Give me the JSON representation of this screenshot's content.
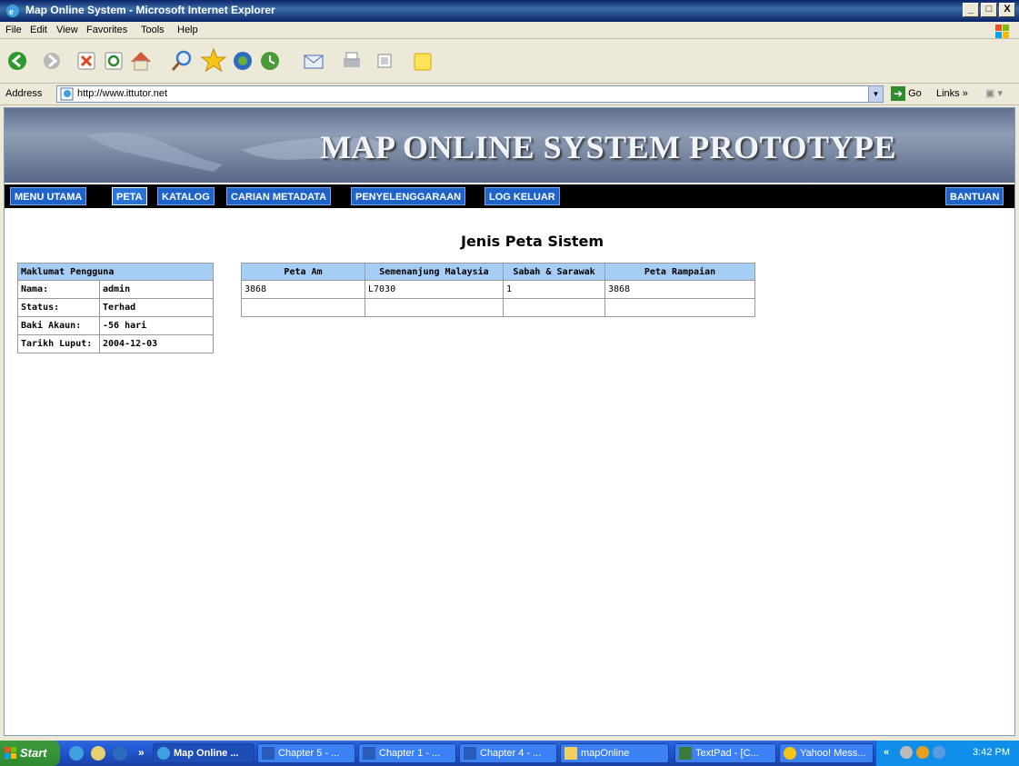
{
  "window": {
    "title": "Map Online System - Microsoft Internet Explorer",
    "controls": [
      "_",
      "□",
      "X"
    ]
  },
  "menubar": [
    "File",
    "Edit",
    "View",
    "Favorites",
    "Tools",
    "Help"
  ],
  "address": {
    "label": "Address",
    "url": "http://www.ittutor.net",
    "go_label": "Go",
    "links_label": "Links »"
  },
  "banner": {
    "title": "MAP ONLINE SYSTEM PROTOTYPE"
  },
  "nav": {
    "items": [
      "MENU UTAMA",
      "PETA",
      "KATALOG",
      "CARIAN METADATA",
      "PENYELENGGARAAN",
      "LOG KELUAR"
    ],
    "help": "BANTUAN",
    "active": "PETA",
    "colors": {
      "bar": "#000000",
      "button": "#1E63C8"
    }
  },
  "page": {
    "heading": "Jenis Peta Sistem"
  },
  "user_info": {
    "header": "Maklumat Pengguna",
    "rows": [
      {
        "label": "Nama:",
        "value": "admin"
      },
      {
        "label": "Status:",
        "value": "Terhad"
      },
      {
        "label": "Baki Akaun:",
        "value": "-56 hari"
      },
      {
        "label": "Tarikh Luput:",
        "value": "2004-12-03"
      }
    ]
  },
  "map_types": {
    "columns": [
      "Peta Am",
      "Semenanjung Malaysia",
      "Sabah & Sarawak",
      "Peta Rampaian"
    ],
    "rows": [
      [
        "3868",
        "L7030",
        "1",
        "3868"
      ],
      [
        "",
        "",
        "",
        ""
      ]
    ],
    "header_color": "#A6CDF5"
  },
  "taskbar": {
    "start_label": "Start",
    "tasks": [
      "Map Online ...",
      "Chapter 5 - ...",
      "Chapter 1 - ...",
      "Chapter 4 - ...",
      "mapOnline",
      "TextPad - [C...",
      "Yahoo! Mess..."
    ],
    "clock": "3:42 PM"
  }
}
